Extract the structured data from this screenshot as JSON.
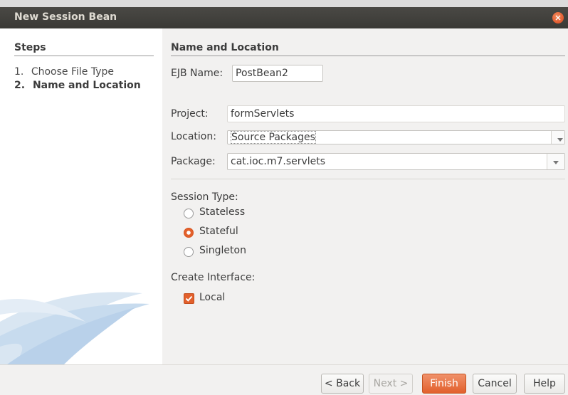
{
  "window": {
    "title": "New Session Bean"
  },
  "steps": {
    "heading": "Steps",
    "items": [
      {
        "num": "1.",
        "label": "Choose File Type"
      },
      {
        "num": "2.",
        "label": "Name and Location"
      }
    ]
  },
  "panel": {
    "title": "Name and Location",
    "ejb_name": {
      "label": "EJB Name:",
      "value": "PostBean2"
    },
    "project": {
      "label": "Project:",
      "value": "formServlets"
    },
    "location": {
      "label": "Location:",
      "value": "Source Packages"
    },
    "package": {
      "label": "Package:",
      "value": "cat.ioc.m7.servlets"
    },
    "session_type": {
      "label": "Session Type:",
      "options": [
        {
          "label": "Stateless",
          "selected": false
        },
        {
          "label": "Stateful",
          "selected": true
        },
        {
          "label": "Singleton",
          "selected": false
        }
      ]
    },
    "create_interface": {
      "label": "Create Interface:",
      "local": {
        "label": "Local",
        "checked": true
      }
    }
  },
  "buttons": {
    "back": "< Back",
    "next": "Next >",
    "finish": "Finish",
    "cancel": "Cancel",
    "help": "Help"
  },
  "colors": {
    "accent": "#e2602c",
    "titlebar": "#3c3b37"
  }
}
